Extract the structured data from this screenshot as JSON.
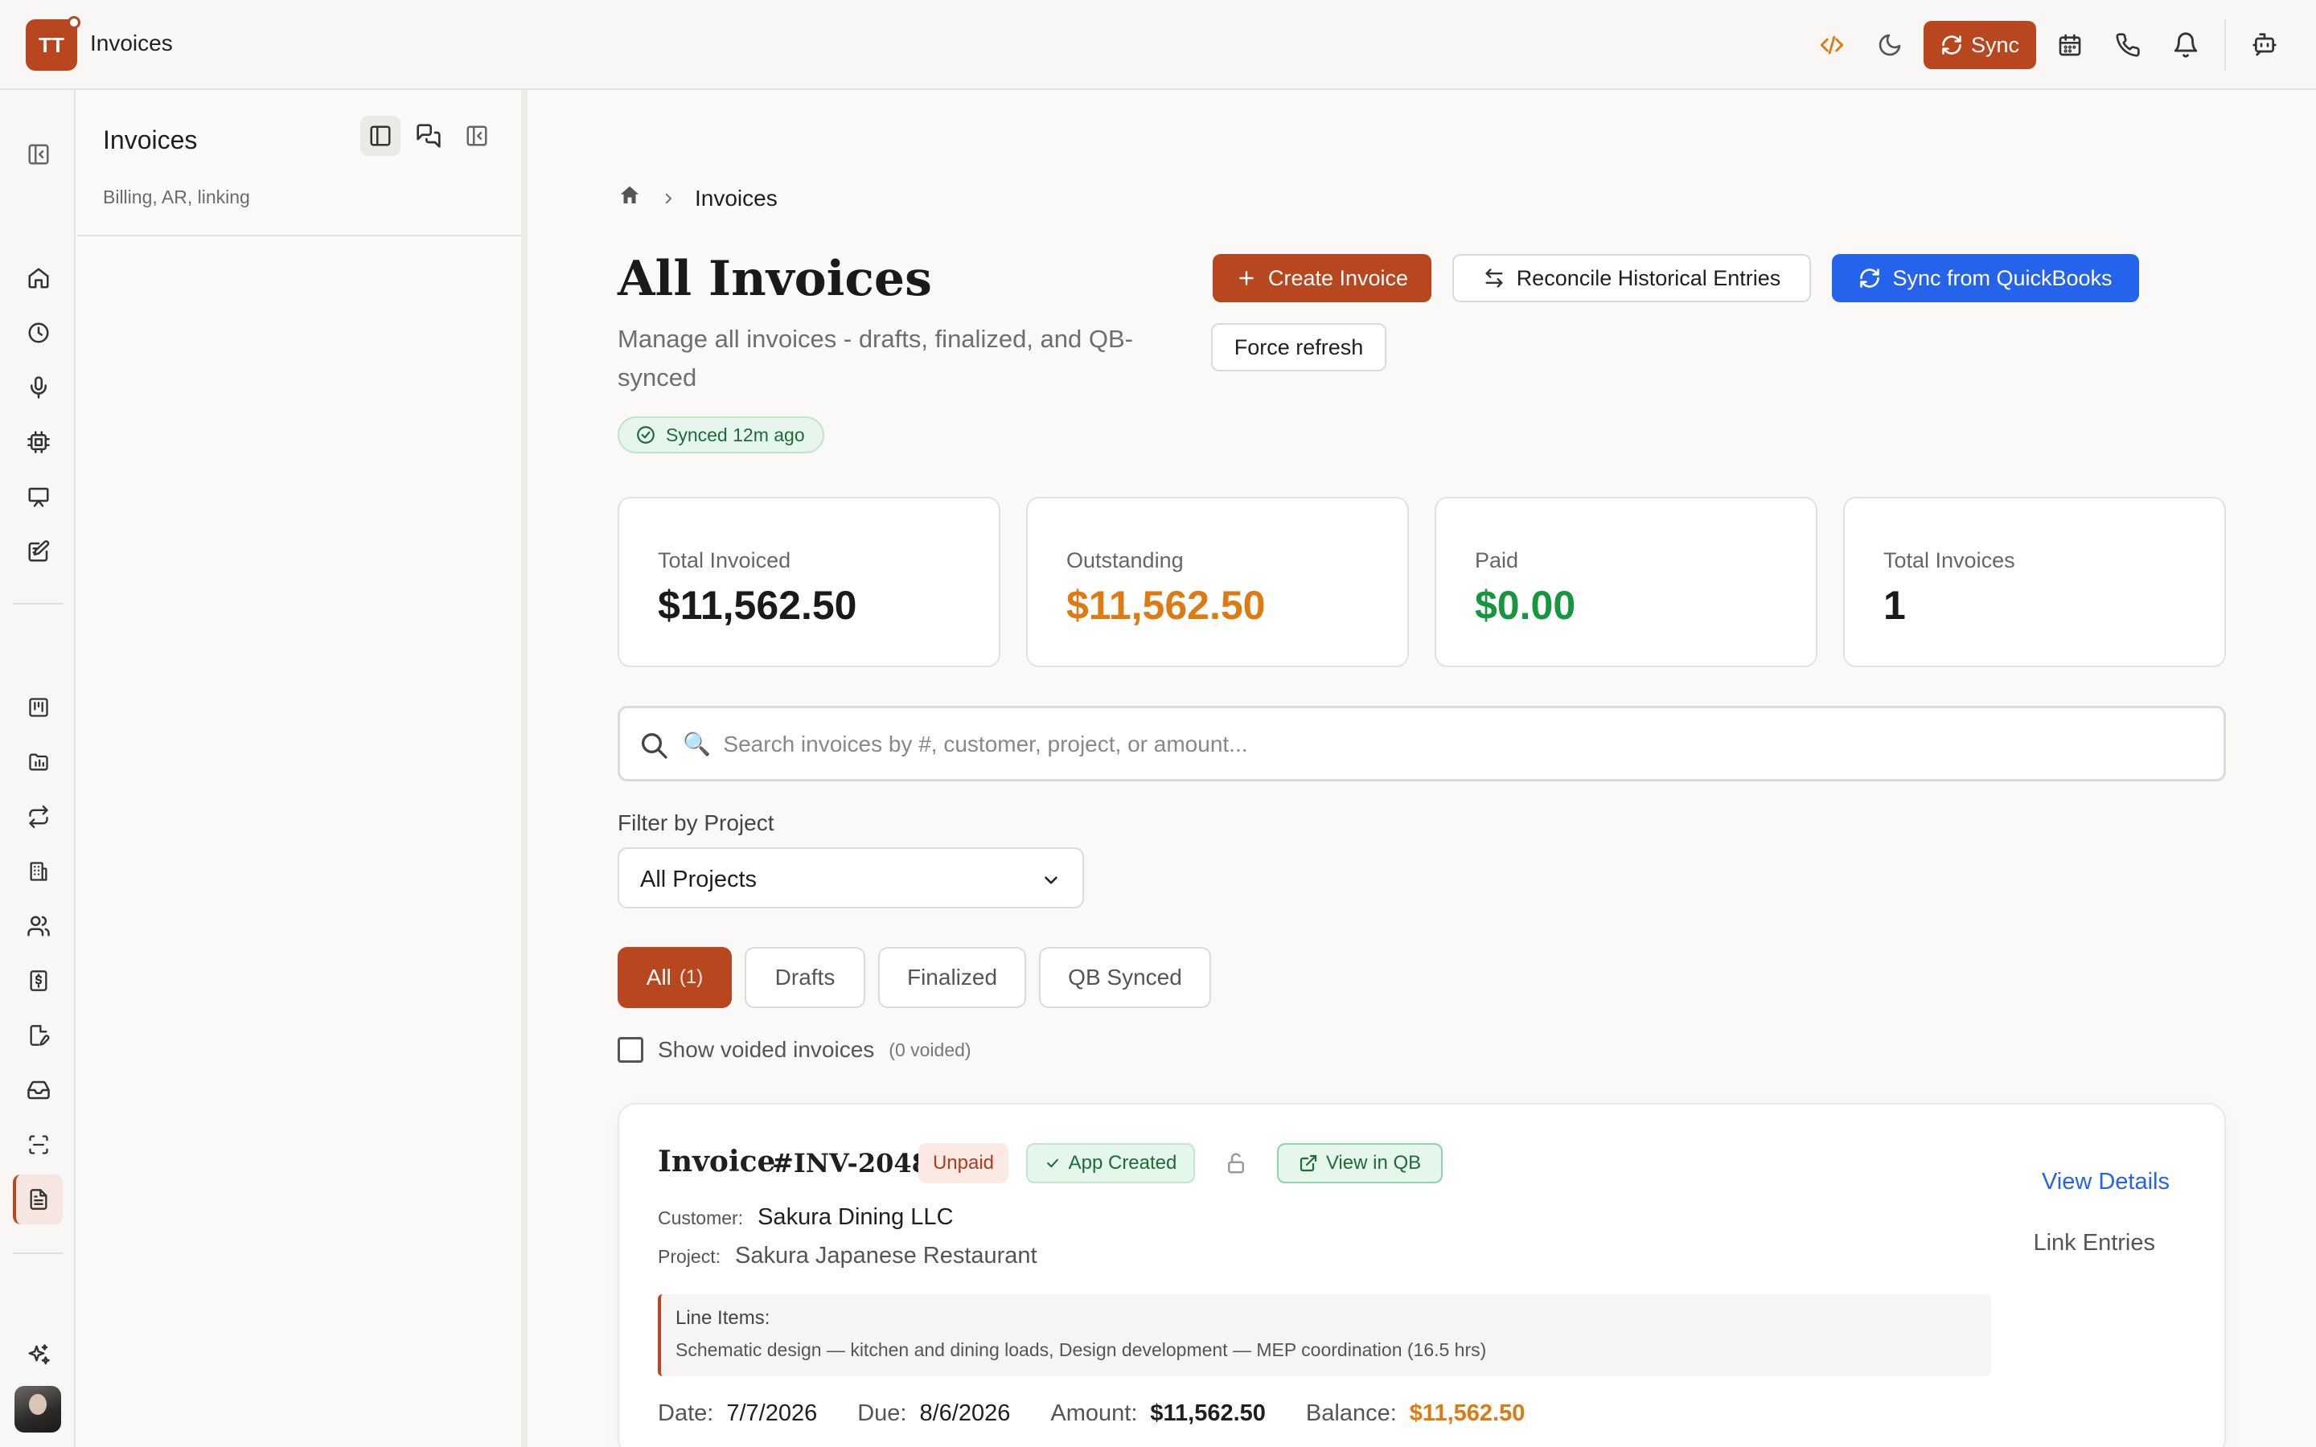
{
  "app": {
    "logo_text": "TT",
    "title": "Invoices",
    "sync_label": "Sync"
  },
  "panel": {
    "title": "Invoices",
    "subtitle": "Billing, AR, linking"
  },
  "breadcrumb": {
    "current": "Invoices"
  },
  "header": {
    "title": "All Invoices",
    "description": "Manage all invoices - drafts, finalized, and QB-synced",
    "sync_status": "Synced 12m ago",
    "create_label": "Create Invoice",
    "reconcile_label": "Reconcile Historical Entries",
    "sync_qb_label": "Sync from QuickBooks",
    "force_refresh_label": "Force refresh"
  },
  "stats": [
    {
      "label": "Total Invoiced",
      "value": "$11,562.50",
      "color": "#1a1a1a"
    },
    {
      "label": "Outstanding",
      "value": "$11,562.50",
      "color": "#dd7a12"
    },
    {
      "label": "Paid",
      "value": "$0.00",
      "color": "#15963f"
    },
    {
      "label": "Total Invoices",
      "value": "1",
      "color": "#1a1a1a"
    }
  ],
  "search": {
    "placeholder": "🔍  Search invoices by #, customer, project, or amount..."
  },
  "filter": {
    "label": "Filter by Project",
    "selected": "All Projects"
  },
  "tabs": [
    {
      "label": "All",
      "count": "(1)"
    },
    {
      "label": "Drafts"
    },
    {
      "label": "Finalized"
    },
    {
      "label": "QB Synced"
    }
  ],
  "voided": {
    "label": "Show voided invoices",
    "count": "(0 voided)"
  },
  "invoice": {
    "title": "Invoice",
    "number": "#INV-2048",
    "status": "Unpaid",
    "source": "App Created",
    "qb_link": "View in QB",
    "view_details": "View Details",
    "link_entries": "Link Entries",
    "customer_label": "Customer:",
    "customer": "Sakura Dining LLC",
    "project_label": "Project:",
    "project": "Sakura Japanese Restaurant",
    "line_items_label": "Line Items:",
    "line_items": "Schematic design — kitchen and dining loads, Design development — MEP coordination (16.5 hrs)",
    "date_label": "Date:",
    "date": "7/7/2026",
    "due_label": "Due:",
    "due": "8/6/2026",
    "amount_label": "Amount:",
    "amount": "$11,562.50",
    "balance_label": "Balance:",
    "balance": "$11,562.50"
  },
  "colors": {
    "accent": "#b8461f",
    "blue": "#2563eb",
    "success": "#15963f",
    "warning": "#dd7a12"
  },
  "icons": {
    "top": [
      "code-icon",
      "moon-icon",
      "calendar-icon",
      "phone-icon",
      "bell-icon",
      "bot-icon"
    ],
    "rail": [
      "sidebar-toggle-icon",
      "home-icon",
      "clock-icon",
      "mic-icon",
      "chip-icon",
      "presentation-icon",
      "edit-note-icon",
      "kanban-icon",
      "folder-chart-icon",
      "repeat-icon",
      "building-icon",
      "users-icon",
      "dollar-doc-icon",
      "file-edit-icon",
      "inbox-icon",
      "scan-icon",
      "invoice-doc-icon",
      "sparkles-icon"
    ]
  }
}
